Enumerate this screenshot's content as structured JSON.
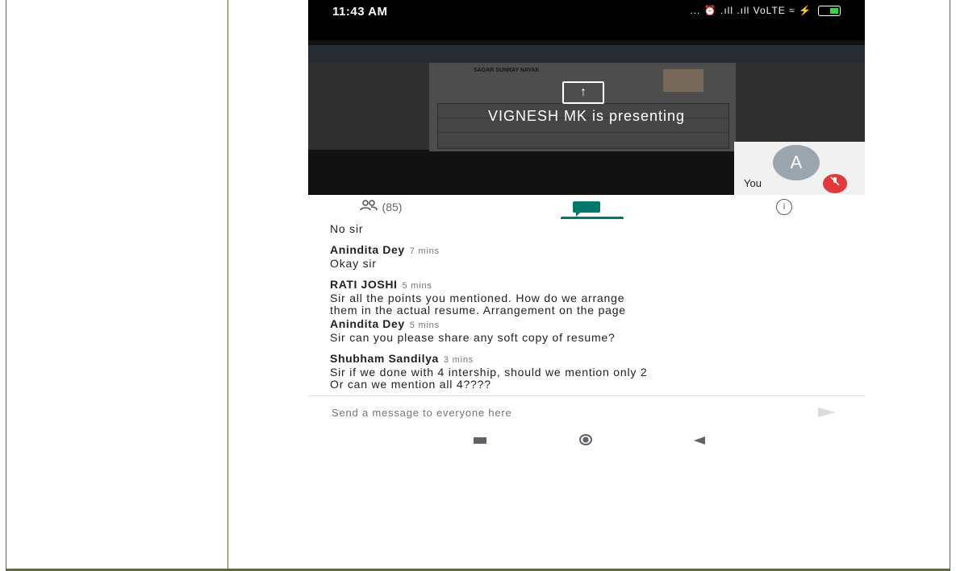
{
  "status_bar": {
    "time": "11:43 AM",
    "indicators": "... ⏰ .ıll .ıll VoLTE ≈ ⚡"
  },
  "presentation": {
    "doc_title": "SAGAR SUNRAY NAYAK",
    "upload_icon": "↑",
    "presenting_text": "VIGNESH MK is presenting",
    "self_avatar_letter": "A",
    "self_label": "You",
    "mic_off_icon": "mic-off-icon"
  },
  "tabs": {
    "people_count": "(85)",
    "people_icon": "people-icon",
    "chat_icon": "chat-icon",
    "info_icon": "info-icon",
    "active": "chat"
  },
  "chat": {
    "partial_message": "No sir",
    "messages": [
      {
        "sender": "Anindita Dey",
        "time": "7 mins",
        "lines": [
          "Okay sir"
        ]
      },
      {
        "sender": "RATI JOSHI",
        "time": "5 mins",
        "lines": [
          "Sir all the points you mentioned. How do we arrange",
          "them in the actual resume. Arrangement on the page"
        ]
      },
      {
        "sender": "Anindita Dey",
        "time": "5 mins",
        "lines": [
          "Sir can you please share any soft copy of  resume?"
        ]
      },
      {
        "sender": "Shubham Sandilya",
        "time": "3 mins",
        "lines": [
          "Sir if we done with 4 intership, should we mention only 2",
          "Or can we mention all 4????"
        ]
      }
    ]
  },
  "composer": {
    "placeholder": "Send a message to everyone here"
  },
  "colors": {
    "accent": "#00796b",
    "mic_off": "#e23a3a",
    "table_border": "#606b3c"
  }
}
